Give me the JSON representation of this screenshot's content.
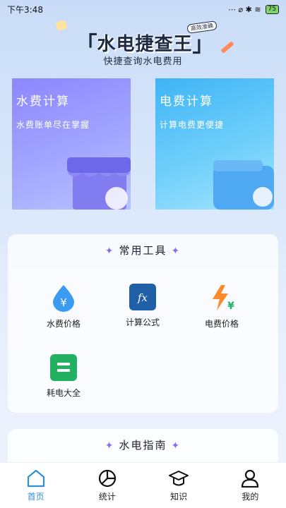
{
  "status_bar": {
    "time": "下午3:48",
    "indicators": "⋯ ⌀ ✱ ≋",
    "battery": "75"
  },
  "header": {
    "title": "水电捷查王",
    "badge": "高效准确",
    "subtitle": "快捷查询水电费用"
  },
  "cards": [
    {
      "title": "水费计算",
      "subtitle": "水费账单尽在掌握",
      "icon": "store-icon"
    },
    {
      "title": "电费计算",
      "subtitle": "计算电费更便捷",
      "icon": "wallet-icon"
    }
  ],
  "tools": {
    "heading": "常用工具",
    "items": [
      {
        "label": "水费价格",
        "icon": "water-drop-yen-icon"
      },
      {
        "label": "计算公式",
        "icon": "fx-icon"
      },
      {
        "label": "电费价格",
        "icon": "lightning-yen-icon"
      },
      {
        "label": "耗电大全",
        "icon": "list-icon"
      }
    ]
  },
  "guide": {
    "heading": "水电指南"
  },
  "nav": {
    "items": [
      {
        "label": "首页",
        "icon": "home-icon",
        "active": true
      },
      {
        "label": "统计",
        "icon": "pie-chart-icon",
        "active": false
      },
      {
        "label": "知识",
        "icon": "graduation-cap-icon",
        "active": false
      },
      {
        "label": "我的",
        "icon": "user-icon",
        "active": false
      }
    ]
  },
  "colors": {
    "accent": "#2f8fd6",
    "water_card": "#8d86ff",
    "power_card": "#3fb4f6"
  }
}
